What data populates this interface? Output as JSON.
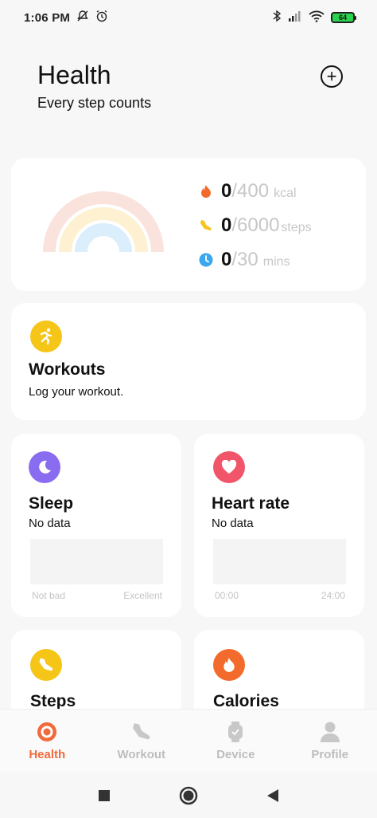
{
  "status_bar": {
    "time": "1:06 PM",
    "battery": "64"
  },
  "header": {
    "title": "Health",
    "subtitle": "Every step counts"
  },
  "summary": {
    "rings": {
      "outer_color": "#fbe3dd",
      "middle_color": "#fdf1d2",
      "inner_color": "#dbeefb"
    },
    "metrics": [
      {
        "icon": "flame-icon",
        "value": "0",
        "target": "/400",
        "unit": "kcal",
        "color": "#f26b2d"
      },
      {
        "icon": "shoe-icon",
        "value": "0",
        "target": "/6000",
        "unit": "steps",
        "color": "#f5c518"
      },
      {
        "icon": "clock-icon",
        "value": "0",
        "target": "/30",
        "unit": "mins",
        "color": "#3aa7f0"
      }
    ]
  },
  "workouts": {
    "title": "Workouts",
    "subtitle": "Log your workout.",
    "icon": "running-icon",
    "color": "#f5c518"
  },
  "sleep": {
    "title": "Sleep",
    "status": "No data",
    "axis_left": "Not bad",
    "axis_right": "Excellent",
    "icon": "moon-icon",
    "color": "#8a6cf0"
  },
  "heart_rate": {
    "title": "Heart rate",
    "status": "No data",
    "axis_left": "00:00",
    "axis_right": "24:00",
    "icon": "heart-icon",
    "color": "#f0556a"
  },
  "steps": {
    "title": "Steps",
    "icon": "shoe-icon",
    "color": "#f5c518"
  },
  "calories": {
    "title": "Calories",
    "icon": "flame-icon",
    "color": "#f26b2d"
  },
  "tabs": [
    {
      "label": "Health",
      "icon": "health-ring-icon",
      "active": true
    },
    {
      "label": "Workout",
      "icon": "shoe-icon",
      "active": false
    },
    {
      "label": "Device",
      "icon": "watch-icon",
      "active": false
    },
    {
      "label": "Profile",
      "icon": "person-icon",
      "active": false
    }
  ],
  "colors": {
    "accent": "#f06a3c",
    "inactive": "#bdbdbd"
  }
}
